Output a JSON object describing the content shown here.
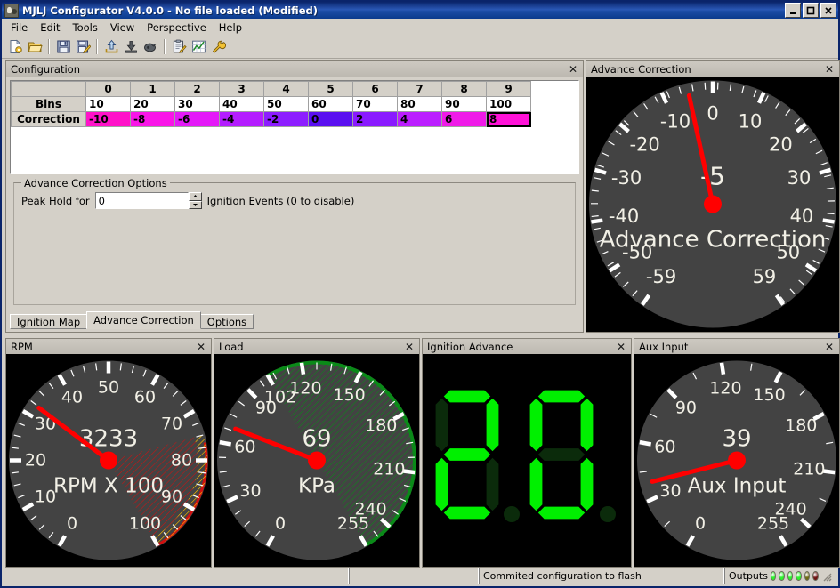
{
  "window": {
    "title": "MJLJ Configurator V4.0.0 - No file loaded (Modified)",
    "icon": "app-dog-icon",
    "minimize_label": "–",
    "maximize_label": "□",
    "close_label": "✕"
  },
  "menu": {
    "items": [
      "File",
      "Edit",
      "Tools",
      "View",
      "Perspective",
      "Help"
    ]
  },
  "toolbar": {
    "buttons": [
      {
        "name": "new-file-icon",
        "tip": "New"
      },
      {
        "name": "open-folder-icon",
        "tip": "Open"
      },
      {
        "name": "save-icon",
        "tip": "Save"
      },
      {
        "name": "save-as-icon",
        "tip": "Save As"
      },
      {
        "name": "upload-icon",
        "tip": "Upload to device"
      },
      {
        "name": "download-icon",
        "tip": "Download from device"
      },
      {
        "name": "commit-flash-icon",
        "tip": "Commit to flash"
      },
      {
        "name": "clipboard-edit-icon",
        "tip": "Edit configuration"
      },
      {
        "name": "chart-icon",
        "tip": "Chart"
      },
      {
        "name": "wrench-icon",
        "tip": "Settings"
      }
    ]
  },
  "configuration": {
    "title": "Configuration",
    "close_label": "✕",
    "columns": [
      "0",
      "1",
      "2",
      "3",
      "4",
      "5",
      "6",
      "7",
      "8",
      "9"
    ],
    "rows": [
      {
        "header": "Bins",
        "values": [
          "10",
          "20",
          "30",
          "40",
          "50",
          "60",
          "70",
          "80",
          "90",
          "100"
        ]
      },
      {
        "header": "Correction",
        "values": [
          "-10",
          "-8",
          "-6",
          "-4",
          "-2",
          "0",
          "2",
          "4",
          "6",
          "8"
        ]
      }
    ],
    "correction_colors": [
      "#ff12c9",
      "#f915e8",
      "#e419f8",
      "#b41cff",
      "#8d1dff",
      "#5a10f0",
      "#8a1aff",
      "#bb1eff",
      "#ef1ae8",
      "#ff12d8"
    ],
    "selected_cell": 9,
    "options": {
      "group_title": "Advance Correction Options",
      "label_before": "Peak Hold for",
      "value": "0",
      "placeholder": "0",
      "label_after": "Ignition Events (0 to disable)",
      "spin_up": "▲",
      "spin_down": "▼"
    },
    "tabs": [
      {
        "label": "Ignition Map",
        "active": false
      },
      {
        "label": "Advance Correction",
        "active": true
      },
      {
        "label": "Options",
        "active": false
      }
    ]
  },
  "gauges": {
    "advance_correction": {
      "title": "Advance Correction",
      "close_label": "✕",
      "caption": "Advance Correction",
      "value": -5,
      "value_text": "-5",
      "min": -59,
      "max": 59,
      "start_angle": -145,
      "end_angle": 145,
      "ticks": [
        "-59",
        "-50",
        "-40",
        "-30",
        "-20",
        "-10",
        "0",
        "10",
        "20",
        "30",
        "40",
        "50",
        "59"
      ],
      "tick_values": [
        -59,
        -50,
        -40,
        -30,
        -20,
        -10,
        0,
        10,
        20,
        30,
        40,
        50,
        59
      ],
      "minor_step": 2.5,
      "needle_color": "#ff0000",
      "face_color": "#434343",
      "text_color": "#f2f0e6"
    },
    "rpm": {
      "title": "RPM",
      "close_label": "✕",
      "caption": "RPM X 100",
      "value": 32.33,
      "value_text": "3233",
      "min": 0,
      "max": 100,
      "start_angle": -150,
      "end_angle": 150,
      "ticks": [
        "0",
        "10",
        "20",
        "30",
        "40",
        "50",
        "60",
        "70",
        "80",
        "90",
        "100"
      ],
      "tick_values": [
        0,
        10,
        20,
        30,
        40,
        50,
        60,
        70,
        80,
        90,
        100
      ],
      "minor_step": 2.5,
      "warn_start": 75,
      "warn_end": 100,
      "warn_color": "#d01010",
      "warn2_color": "#e8e000",
      "needle_color": "#ff0000",
      "face_color": "#434343",
      "text_color": "#f2f0e6"
    },
    "load": {
      "title": "Load",
      "close_label": "✕",
      "caption": "KPa",
      "value": 69,
      "value_text": "69",
      "min": 0,
      "max": 255,
      "start_angle": -150,
      "end_angle": 150,
      "ticks": [
        "0",
        "30",
        "60",
        "90",
        "120",
        "150",
        "180",
        "210",
        "240",
        "255"
      ],
      "tick_values": [
        0,
        30,
        60,
        90,
        120,
        150,
        180,
        210,
        240,
        255
      ],
      "extra_tick": {
        "label": "102",
        "value": 102
      },
      "minor_step": 7.5,
      "band_start": 102,
      "band_end": 255,
      "band_color": "#0a8a18",
      "needle_color": "#ff0000",
      "face_color": "#434343",
      "text_color": "#f2f0e6"
    },
    "aux_input": {
      "title": "Aux Input",
      "close_label": "✕",
      "caption": "Aux Input",
      "value": 39,
      "value_text": "39",
      "min": 0,
      "max": 255,
      "start_angle": -150,
      "end_angle": 150,
      "ticks": [
        "0",
        "30",
        "60",
        "90",
        "120",
        "150",
        "180",
        "210",
        "240",
        "255"
      ],
      "tick_values": [
        0,
        30,
        60,
        90,
        120,
        150,
        180,
        210,
        240,
        255
      ],
      "minor_step": 15,
      "needle_color": "#ff0000",
      "face_color": "#434343",
      "text_color": "#f2f0e6"
    }
  },
  "ignition_advance": {
    "title": "Ignition Advance",
    "close_label": "✕",
    "value_text": "20",
    "digits": [
      "2",
      "0"
    ],
    "on_color": "#00f000",
    "off_color": "#0b2b0b",
    "background": "#000000"
  },
  "statusbar": {
    "cell1": "",
    "cell2": "",
    "message": "Commited configuration to flash",
    "outputs_label": "Outputs",
    "leds": [
      "#2bf22b",
      "#2bf22b",
      "#2bf22b",
      "#2bf22b",
      "#6e6a12",
      "#6e1212"
    ]
  }
}
